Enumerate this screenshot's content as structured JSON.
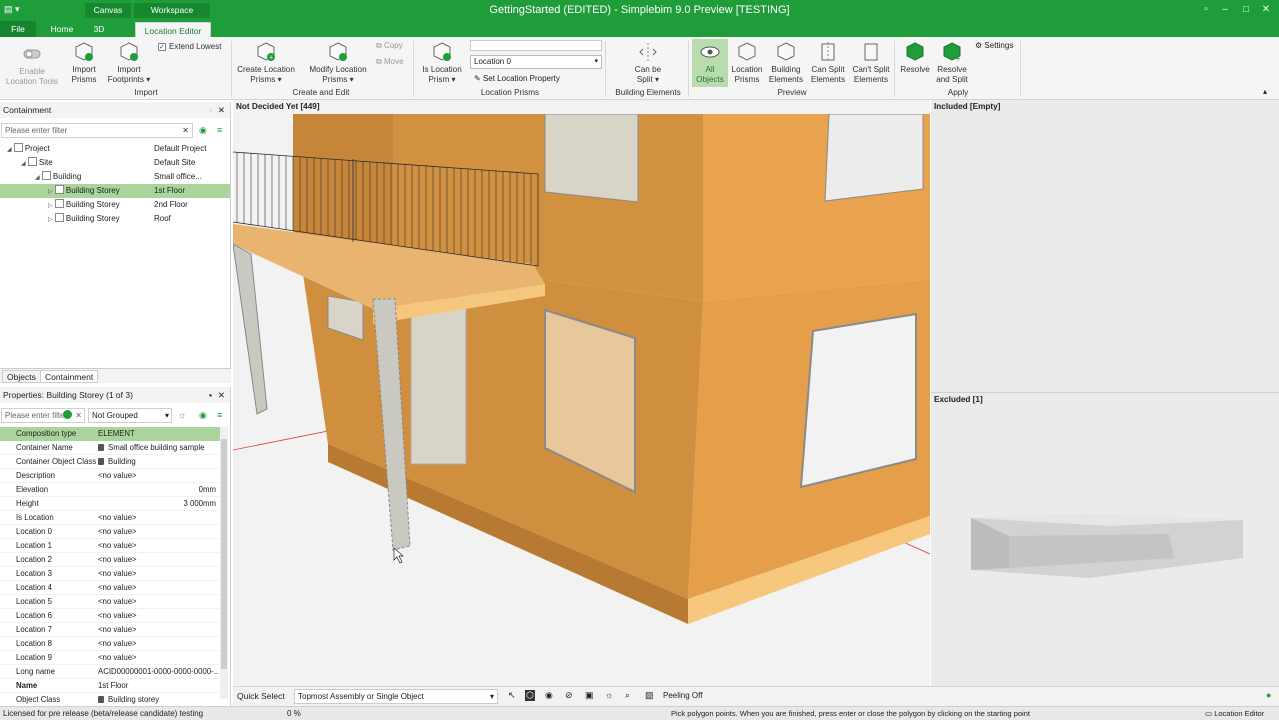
{
  "window": {
    "title": "GettingStarted (EDITED) - Simplebim 9.0 Preview [TESTING]",
    "context_tabs": [
      "Canvas",
      "Workspace"
    ]
  },
  "tabs": [
    "File",
    "Home",
    "3D",
    "Location Editor"
  ],
  "ribbon": {
    "enable_location_tools": "Enable\nLocation Tools",
    "extend_lowest": "Extend Lowest",
    "import_prisms": "Import\nPrisms",
    "import_footprints": "Import\nFootprints ▾",
    "group_import": "Import",
    "create_location_prisms": "Create Location\nPrisms ▾",
    "modify_location_prisms": "Modify Location\nPrisms ▾",
    "copy": "Copy",
    "move": "Move",
    "group_create_edit": "Create and Edit",
    "is_location_prism": "Is Location\nPrism ▾",
    "location_select": "Location 0",
    "set_location_property": "Set Location Property",
    "group_location_prisms": "Location Prisms",
    "can_be_split": "Can be\nSplit ▾",
    "group_building_elements": "Building Elements",
    "all_objects": "All\nObjects",
    "location_prisms": "Location\nPrisms",
    "building_elements": "Building\nElements",
    "can_split_elements": "Can Split\nElements",
    "cant_split_elements": "Can't Split\nElements",
    "group_preview": "Preview",
    "resolve": "Resolve",
    "resolve_and_split": "Resolve\nand Split",
    "settings": "Settings",
    "group_apply": "Apply"
  },
  "containment": {
    "title": "Containment",
    "filter_placeholder": "Please enter filter",
    "rows": [
      {
        "name": "Project",
        "value": "Default Project",
        "indent": 0,
        "expander": "◢"
      },
      {
        "name": "Site",
        "value": "Default Site",
        "indent": 1,
        "expander": "◢"
      },
      {
        "name": "Building",
        "value": "Small office...",
        "indent": 2,
        "expander": "◢"
      },
      {
        "name": "Building Storey",
        "value": "1st Floor",
        "indent": 3,
        "expander": "▷"
      },
      {
        "name": "Building Storey",
        "value": "2nd Floor",
        "indent": 3,
        "expander": "▷"
      },
      {
        "name": "Building Storey",
        "value": "Roof",
        "indent": 3,
        "expander": "▷"
      }
    ],
    "tabs": [
      "Objects",
      "Containment"
    ]
  },
  "properties": {
    "title": "Properties: Building Storey (1 of 3)",
    "filter_placeholder": "Please enter filte",
    "grouping": "Not Grouped",
    "header": {
      "name": "Composition type",
      "value": "ELEMENT"
    },
    "rows": [
      {
        "name": "Container Name",
        "value": "Small office building sample",
        "locked": true
      },
      {
        "name": "Container Object Class",
        "value": "Building",
        "locked": true
      },
      {
        "name": "Description",
        "value": "<no value>"
      },
      {
        "name": "Elevation",
        "value": "0mm",
        "align": "right"
      },
      {
        "name": "Height",
        "value": "3 000mm",
        "align": "right"
      },
      {
        "name": "Is Location",
        "value": "<no value>"
      },
      {
        "name": "Location 0",
        "value": "<no value>"
      },
      {
        "name": "Location 1",
        "value": "<no value>"
      },
      {
        "name": "Location 2",
        "value": "<no value>"
      },
      {
        "name": "Location 3",
        "value": "<no value>"
      },
      {
        "name": "Location 4",
        "value": "<no value>"
      },
      {
        "name": "Location 5",
        "value": "<no value>"
      },
      {
        "name": "Location 6",
        "value": "<no value>"
      },
      {
        "name": "Location 7",
        "value": "<no value>"
      },
      {
        "name": "Location 8",
        "value": "<no value>"
      },
      {
        "name": "Location 9",
        "value": "<no value>"
      },
      {
        "name": "Long name",
        "value": "ACID00000001-0000-0000-0000-..."
      },
      {
        "name": "Name",
        "value": "1st Floor"
      },
      {
        "name": "Object Class",
        "value": "Building storey",
        "locked": true
      }
    ]
  },
  "viewport": {
    "title": "Not Decided Yet [449]"
  },
  "included": {
    "title": "Included [Empty]"
  },
  "excluded": {
    "title": "Excluded [1]"
  },
  "quick_select": {
    "label": "Quick Select",
    "mode": "Topmost Assembly or Single Object",
    "peeling": "Peeling Off"
  },
  "status": {
    "license": "Licensed for pre release (beta/release candidate) testing",
    "progress": "0 %",
    "hint": "Pick polygon points. When you are finished, press enter or close the polygon by clicking on the starting point",
    "mode": "Location Editor"
  },
  "colors": {
    "brand": "#1f9d3a",
    "selection": "#a9d49c",
    "wall": "#d99a48",
    "wall_light": "#f0b566"
  }
}
